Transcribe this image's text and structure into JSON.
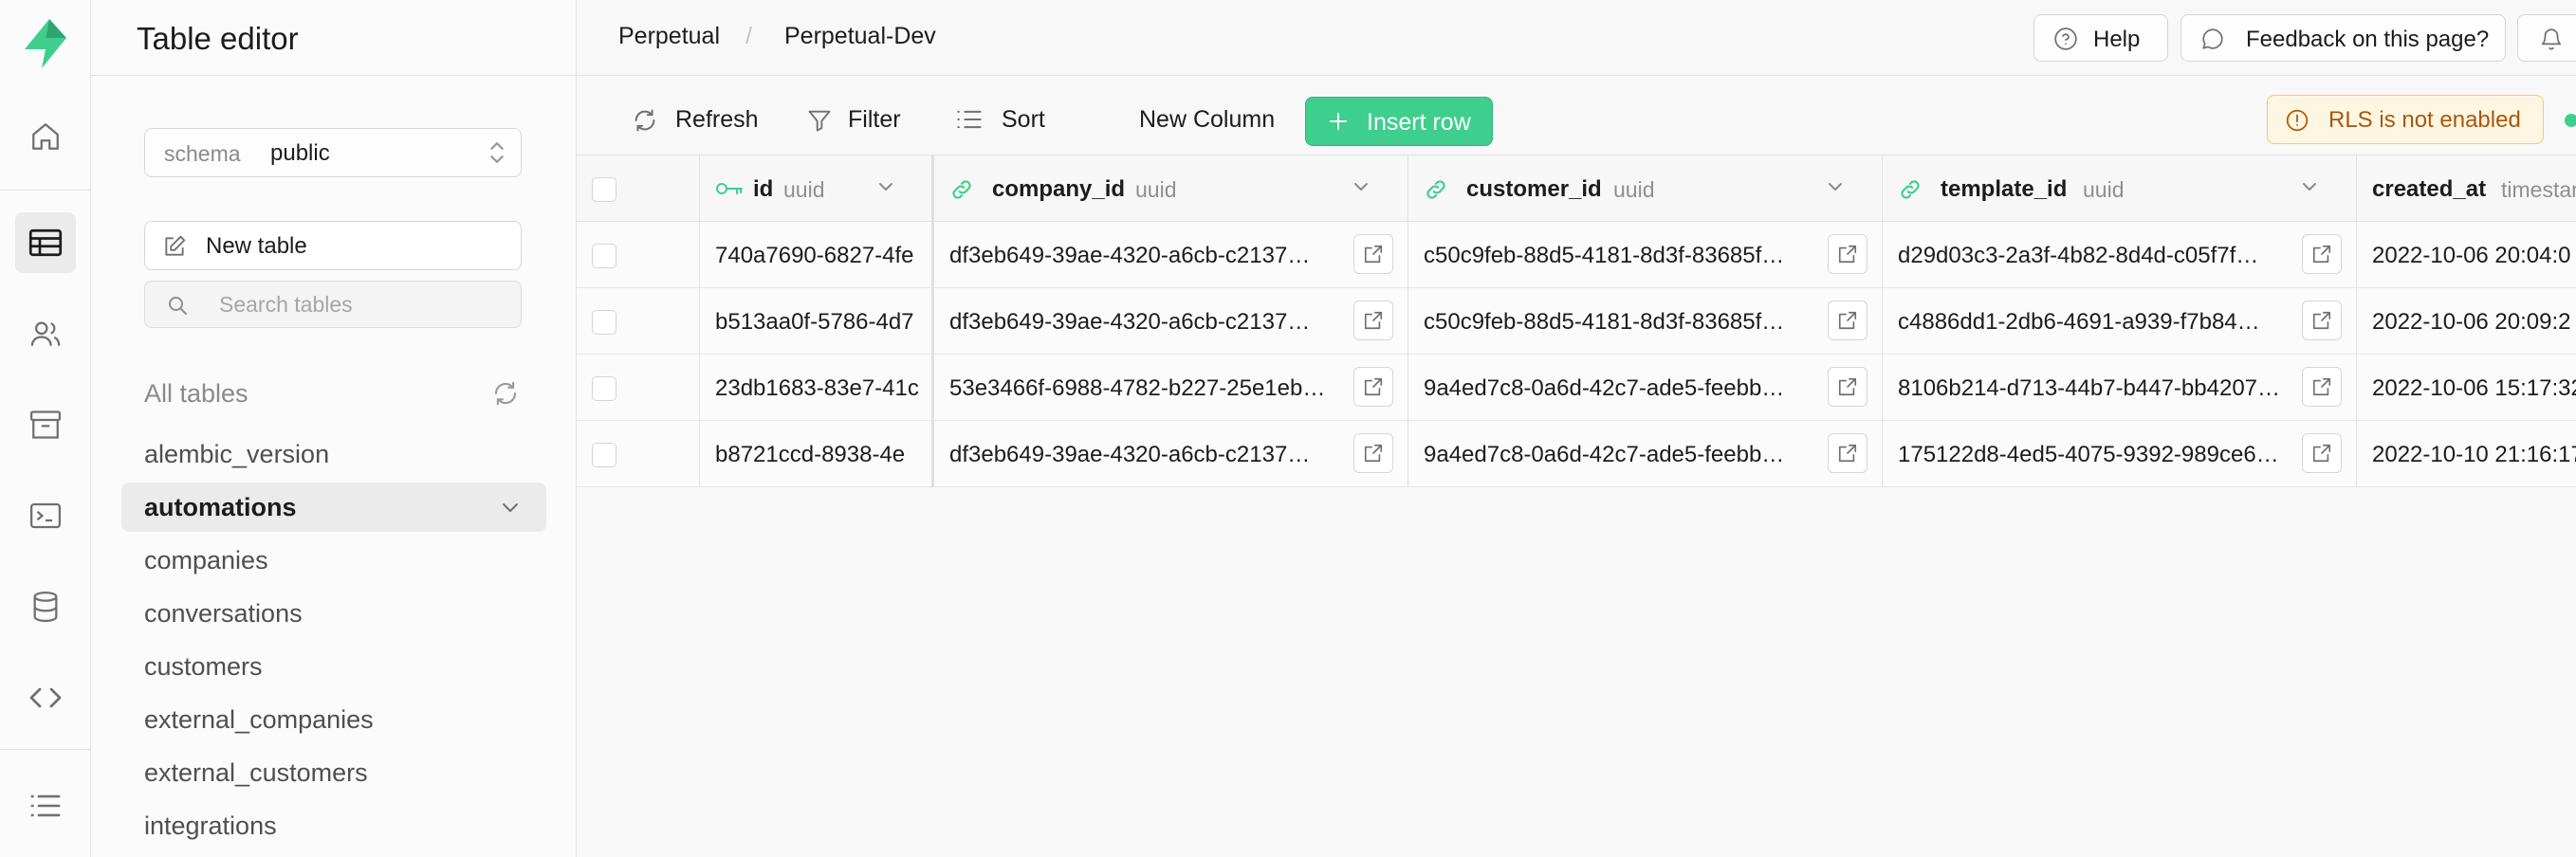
{
  "brand": {
    "accent": "#3ecf8e",
    "warning": "#b15e0a"
  },
  "rail": {
    "items": [
      {
        "icon": "home-icon"
      },
      {
        "icon": "table-editor-icon",
        "active": true
      },
      {
        "icon": "users-icon"
      },
      {
        "icon": "storage-icon"
      },
      {
        "icon": "terminal-icon"
      },
      {
        "icon": "database-icon"
      },
      {
        "icon": "code-icon"
      },
      {
        "icon": "list-icon"
      }
    ]
  },
  "panel": {
    "title": "Table editor",
    "schema_label": "schema",
    "schema_value": "public",
    "new_table_label": "New table",
    "search_placeholder": "Search tables",
    "all_tables_label": "All tables",
    "tables": [
      "alembic_version",
      "automations",
      "companies",
      "conversations",
      "customers",
      "external_companies",
      "external_customers",
      "integrations"
    ],
    "active_table": "automations"
  },
  "header": {
    "crumbs": [
      "Perpetual",
      "Perpetual-Dev"
    ],
    "crumb_separator": "/",
    "help_label": "Help",
    "feedback_label": "Feedback on this page?"
  },
  "toolbar": {
    "refresh_label": "Refresh",
    "filter_label": "Filter",
    "sort_label": "Sort",
    "new_column_label": "New Column",
    "insert_row_label": "Insert row",
    "rls_label": "RLS is not enabled"
  },
  "grid": {
    "columns": [
      {
        "name": "id",
        "type": "uuid",
        "icon": "key-icon"
      },
      {
        "name": "company_id",
        "type": "uuid",
        "icon": "link-icon"
      },
      {
        "name": "customer_id",
        "type": "uuid",
        "icon": "link-icon"
      },
      {
        "name": "template_id",
        "type": "uuid",
        "icon": "link-icon"
      },
      {
        "name": "created_at",
        "type": "timestam"
      }
    ],
    "rows": [
      [
        "740a7690-6827-4fe",
        "df3eb649-39ae-4320-a6cb-c2137…",
        "c50c9feb-88d5-4181-8d3f-83685f…",
        "d29d03c3-2a3f-4b82-8d4d-c05f7f…",
        "2022-10-06 20:04:0"
      ],
      [
        "b513aa0f-5786-4d7",
        "df3eb649-39ae-4320-a6cb-c2137…",
        "c50c9feb-88d5-4181-8d3f-83685f…",
        "c4886dd1-2db6-4691-a939-f7b84…",
        "2022-10-06 20:09:2"
      ],
      [
        "23db1683-83e7-41c",
        "53e3466f-6988-4782-b227-25e1eb…",
        "9a4ed7c8-0a6d-42c7-ade5-feebb…",
        "8106b214-d713-44b7-b447-bb4207…",
        "2022-10-06 15:17:32"
      ],
      [
        "b8721ccd-8938-4e",
        "df3eb649-39ae-4320-a6cb-c2137…",
        "9a4ed7c8-0a6d-42c7-ade5-feebb…",
        "175122d8-4ed5-4075-9392-989ce6…",
        "2022-10-10 21:16:17"
      ]
    ]
  }
}
